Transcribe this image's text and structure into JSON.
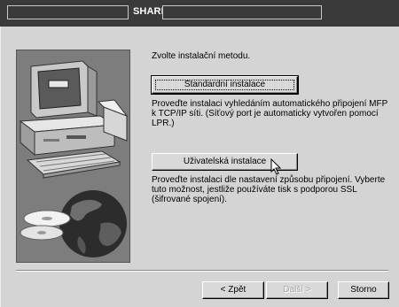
{
  "window": {
    "title": "SHARP"
  },
  "main": {
    "prompt": "Zvolte instalační metodu.",
    "standard_button": "Standardní instalace",
    "standard_description": "Proveďte instalaci vyhledáním automatického připojení MFP k TCP/IP síti. (Síťový port je automaticky vytvořen pomocí LPR.)",
    "custom_button": "Uživatelská instalace",
    "custom_description": "Proveďte instalaci dle nastavení způsobu připojení. Vyberte tuto možnost, jestliže používáte tisk s podporou SSL (šifrované spojení)."
  },
  "footer": {
    "back_label": "< Zpět",
    "next_label": "Další >",
    "cancel_label": "Storno"
  },
  "icons": {
    "cursor": "arrow-cursor-icon",
    "illustration": "computer-cd-globe-illustration"
  }
}
